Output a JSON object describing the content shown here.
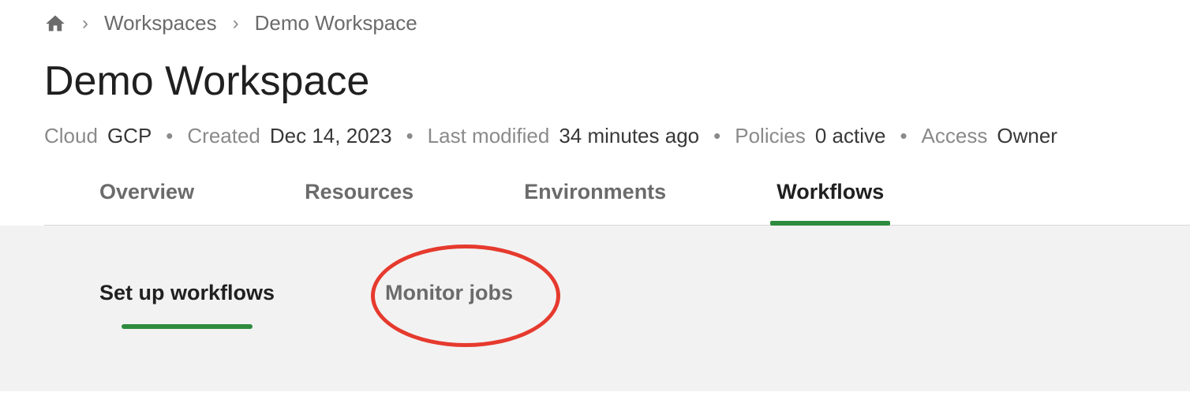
{
  "breadcrumb": {
    "items": [
      {
        "label": "Workspaces"
      },
      {
        "label": "Demo Workspace"
      }
    ]
  },
  "page": {
    "title": "Demo Workspace"
  },
  "meta": {
    "cloud_label": "Cloud",
    "cloud_value": "GCP",
    "created_label": "Created",
    "created_value": "Dec 14, 2023",
    "modified_label": "Last modified",
    "modified_value": "34 minutes ago",
    "policies_label": "Policies",
    "policies_value": "0 active",
    "access_label": "Access",
    "access_value": "Owner"
  },
  "tabs_primary": {
    "items": [
      {
        "label": "Overview"
      },
      {
        "label": "Resources"
      },
      {
        "label": "Environments"
      },
      {
        "label": "Workflows"
      }
    ],
    "active_index": 3
  },
  "tabs_secondary": {
    "items": [
      {
        "label": "Set up workflows"
      },
      {
        "label": "Monitor jobs"
      }
    ],
    "active_index": 0
  }
}
